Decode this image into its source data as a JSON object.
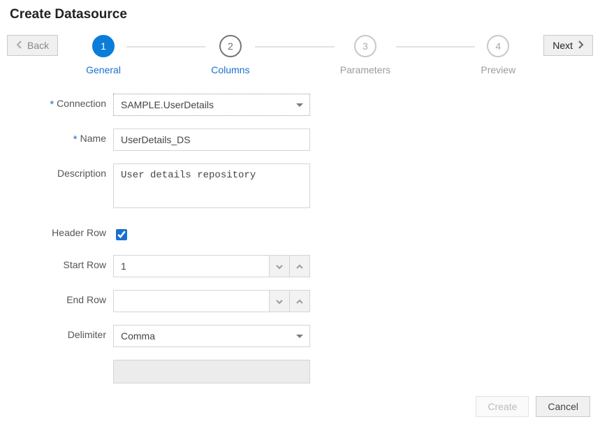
{
  "title": "Create Datasource",
  "nav": {
    "back": "Back",
    "next": "Next"
  },
  "stepper": {
    "steps": [
      {
        "num": "1",
        "label": "General",
        "state": "active"
      },
      {
        "num": "2",
        "label": "Columns",
        "state": "link"
      },
      {
        "num": "3",
        "label": "Parameters",
        "state": "pending"
      },
      {
        "num": "4",
        "label": "Preview",
        "state": "pending"
      }
    ]
  },
  "form": {
    "connection": {
      "label": "Connection",
      "required": true,
      "value": "SAMPLE.UserDetails"
    },
    "name": {
      "label": "Name",
      "required": true,
      "value": "UserDetails_DS"
    },
    "description": {
      "label": "Description",
      "required": false,
      "value": "User details repository"
    },
    "headerRow": {
      "label": "Header Row",
      "checked": true
    },
    "startRow": {
      "label": "Start Row",
      "value": "1"
    },
    "endRow": {
      "label": "End Row",
      "value": ""
    },
    "delimiter": {
      "label": "Delimiter",
      "value": "Comma"
    }
  },
  "footer": {
    "create": "Create",
    "cancel": "Cancel"
  }
}
